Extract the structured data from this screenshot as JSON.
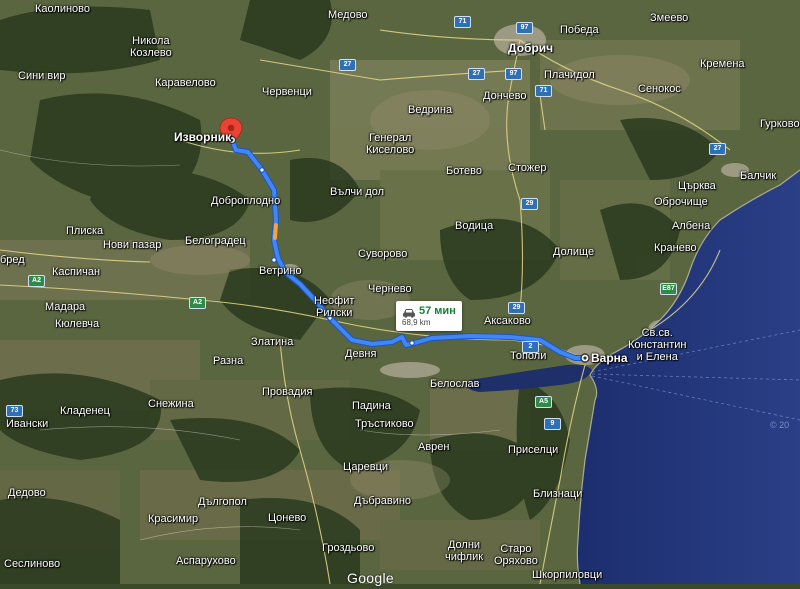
{
  "map": {
    "provider": "Google",
    "view": "satellite",
    "water_name_visible": false
  },
  "route": {
    "from": "Изворник",
    "to": "Варна",
    "duration": "57 мин",
    "distance": "68,9 km",
    "route_color": "#4285f4"
  },
  "places": [
    {
      "key": "kaolinovo",
      "name": "Каолиново"
    },
    {
      "key": "nikola_kozlevo",
      "name": "Никола\nКозлево"
    },
    {
      "key": "sini_vir",
      "name": "Сини вир"
    },
    {
      "key": "karavelovo",
      "name": "Каравелово"
    },
    {
      "key": "chervenci",
      "name": "Червенци"
    },
    {
      "key": "medovo",
      "name": "Медово"
    },
    {
      "key": "pobeda",
      "name": "Победа"
    },
    {
      "key": "dobrich",
      "name": "Добрич"
    },
    {
      "key": "plachidol",
      "name": "Плачидол"
    },
    {
      "key": "zmeevo",
      "name": "Змеево"
    },
    {
      "key": "kremena",
      "name": "Кремена"
    },
    {
      "key": "senokos",
      "name": "Сенокос"
    },
    {
      "key": "gurkovo",
      "name": "Гурково"
    },
    {
      "key": "donchevo",
      "name": "Дончево"
    },
    {
      "key": "vedrina",
      "name": "Ведрина"
    },
    {
      "key": "general_kiselovo",
      "name": "Генерал\nКиселово"
    },
    {
      "key": "botevo",
      "name": "Ботево"
    },
    {
      "key": "stozher",
      "name": "Стожер"
    },
    {
      "key": "balchik",
      "name": "Балчик"
    },
    {
      "key": "tsarkva",
      "name": "Църква"
    },
    {
      "key": "obrochishte",
      "name": "Оброчище"
    },
    {
      "key": "albena",
      "name": "Албена"
    },
    {
      "key": "kranevo",
      "name": "Кранево"
    },
    {
      "key": "dobroplodno",
      "name": "Доброплодно"
    },
    {
      "key": "valchi_dol",
      "name": "Вълчи дол"
    },
    {
      "key": "vodica",
      "name": "Водица"
    },
    {
      "key": "dolishte",
      "name": "Долище"
    },
    {
      "key": "pliska",
      "name": "Плиска"
    },
    {
      "key": "novi_pazar",
      "name": "Нови пазар"
    },
    {
      "key": "belogradets",
      "name": "Белоградец"
    },
    {
      "key": "suvorovo",
      "name": "Суворово"
    },
    {
      "key": "kaspichan",
      "name": "Каспичан"
    },
    {
      "key": "vetrino",
      "name": "Ветрино"
    },
    {
      "key": "chernevo",
      "name": "Чернево"
    },
    {
      "key": "aksakovo",
      "name": "Аксаково"
    },
    {
      "key": "madara",
      "name": "Мадара"
    },
    {
      "key": "kyulevcha",
      "name": "Кюлевча"
    },
    {
      "key": "neofit_rilski",
      "name": "Неофит\nРилски"
    },
    {
      "key": "devnya",
      "name": "Девня"
    },
    {
      "key": "topoli",
      "name": "Тополи"
    },
    {
      "key": "sv_konstantin",
      "name": "Св.св.\nКонстантин\nи Елена"
    },
    {
      "key": "razna",
      "name": "Разна"
    },
    {
      "key": "zlatina",
      "name": "Златина"
    },
    {
      "key": "provadia",
      "name": "Провадия"
    },
    {
      "key": "beloslav",
      "name": "Белослав"
    },
    {
      "key": "ivanski",
      "name": "Ивански"
    },
    {
      "key": "kladenets",
      "name": "Кладенец"
    },
    {
      "key": "snezhina",
      "name": "Снежина"
    },
    {
      "key": "padina",
      "name": "Падина"
    },
    {
      "key": "trastikovo",
      "name": "Тръстиково"
    },
    {
      "key": "avren",
      "name": "Аврен"
    },
    {
      "key": "priseltsi",
      "name": "Приселци"
    },
    {
      "key": "tsarevtsi",
      "name": "Царевци"
    },
    {
      "key": "blizhnatsi",
      "name": "Близнаци"
    },
    {
      "key": "darvodelovo",
      "name": "Дедово"
    },
    {
      "key": "dalgopol",
      "name": "Дългопол"
    },
    {
      "key": "tsonevo",
      "name": "Цонево"
    },
    {
      "key": "dabravino",
      "name": "Дъбравино"
    },
    {
      "key": "krasimir",
      "name": "Красимир"
    },
    {
      "key": "asparuhovo",
      "name": "Аспарухово"
    },
    {
      "key": "grozdyovo",
      "name": "Гроздьово"
    },
    {
      "key": "dolni_chiflik",
      "name": "Долни\nчифлик"
    },
    {
      "key": "staro_oryahovo",
      "name": "Старо\nОряхово"
    },
    {
      "key": "shkorpilovtsi",
      "name": "Шкорпиловци"
    },
    {
      "key": "selinovo",
      "name": "Сеслиново"
    },
    {
      "key": "bred",
      "name": "бред"
    }
  ],
  "route_labels": {
    "origin": "Изворник",
    "destination": "Варна"
  },
  "road_shields": [
    {
      "key": "r71",
      "num": "71",
      "type": "national"
    },
    {
      "key": "r97",
      "num": "97",
      "type": "national"
    },
    {
      "key": "r27a",
      "num": "27",
      "type": "national"
    },
    {
      "key": "r97b",
      "num": "97",
      "type": "national"
    },
    {
      "key": "r71b",
      "num": "71",
      "type": "national"
    },
    {
      "key": "r27b",
      "num": "27",
      "type": "national"
    },
    {
      "key": "r27c",
      "num": "27",
      "type": "national"
    },
    {
      "key": "r29a",
      "num": "29",
      "type": "national"
    },
    {
      "key": "r29b",
      "num": "29",
      "type": "national"
    },
    {
      "key": "r2",
      "num": "2",
      "type": "national"
    },
    {
      "key": "a2a",
      "num": "A2",
      "type": "motorway"
    },
    {
      "key": "a2b",
      "num": "A2",
      "type": "motorway"
    },
    {
      "key": "e87",
      "num": "E87",
      "type": "motorway"
    },
    {
      "key": "a5",
      "num": "A5",
      "type": "motorway"
    },
    {
      "key": "r9",
      "num": "9",
      "type": "national"
    },
    {
      "key": "r73",
      "num": "73",
      "type": "national"
    }
  ],
  "branding": {
    "logo": "Google",
    "copyright": "© 20"
  }
}
